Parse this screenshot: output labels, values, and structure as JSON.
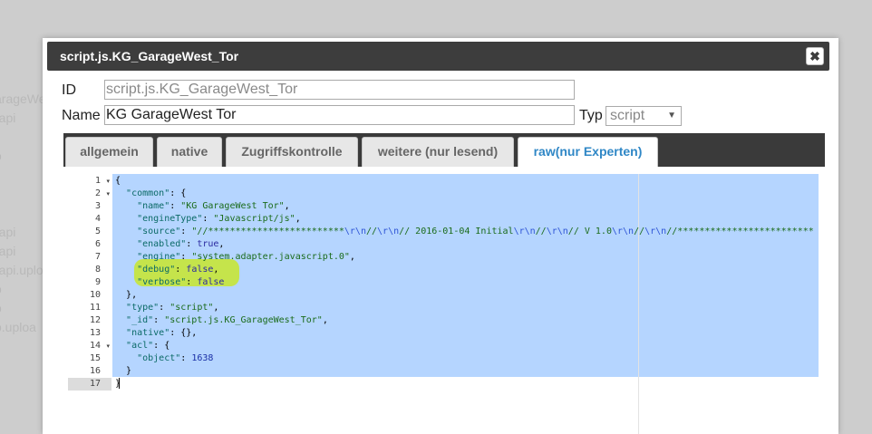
{
  "background": {
    "items": [
      "arageWe",
      "-api",
      "o",
      "-api",
      "-api",
      "-api.uplo",
      "o",
      "o",
      "o.uploa"
    ]
  },
  "dialog": {
    "title": "script.js.KG_GarageWest_Tor",
    "close_glyph": "✖"
  },
  "form": {
    "id_label": "ID",
    "id_value": "script.js.KG_GarageWest_Tor",
    "name_label": "Name",
    "name_value": "KG GarageWest Tor",
    "type_label": "Typ",
    "type_value": "script"
  },
  "tabs": [
    {
      "label": "allgemein"
    },
    {
      "label": "native"
    },
    {
      "label": "Zugriffskontrolle"
    },
    {
      "label": "weitere (nur lesend)"
    },
    {
      "label": "raw(nur Experten)"
    }
  ],
  "editor": {
    "line_numbers": [
      "1",
      "2",
      "3",
      "4",
      "5",
      "6",
      "7",
      "8",
      "9",
      "10",
      "11",
      "12",
      "13",
      "14",
      "15",
      "16",
      "17"
    ],
    "fold_marker": "▾",
    "code": {
      "l1_brace": "{",
      "l2_key": "\"common\"",
      "l2_rest": ": {",
      "l3_key": "\"name\"",
      "l3_val": "\"KG GarageWest Tor\"",
      "l4_key": "\"engineType\"",
      "l4_val": "\"Javascript/js\"",
      "l5_key": "\"source\"",
      "l5_a": "\"//*************************",
      "l5_b": "\\r\\n",
      "l5_c": "//",
      "l5_d": "\\r\\n",
      "l5_e": "// 2016-01-04 Initial",
      "l5_f": "\\r\\n",
      "l5_g": "//",
      "l5_h": "\\r\\n",
      "l5_i": "// V 1.0",
      "l5_j": "\\r\\n",
      "l5_k": "//",
      "l5_l": "\\r\\n",
      "l5_m": "//*************************",
      "l6_key": "\"enabled\"",
      "l6_val": "true",
      "l7_key": "\"engine\"",
      "l7_val": "\"system.adapter.javascript.0\"",
      "l8_key": "\"debug\"",
      "l8_val": "false",
      "l9_key": "\"verbose\"",
      "l9_val": "false",
      "l10_text": "},",
      "l11_key": "\"type\"",
      "l11_val": "\"script\"",
      "l12_key": "\"_id\"",
      "l12_val": "\"script.js.KG_GarageWest_Tor\"",
      "l13_key": "\"native\"",
      "l13_rest": ": {},",
      "l14_key": "\"acl\"",
      "l14_rest": ": {",
      "l15_key": "\"object\"",
      "l15_val": "1638",
      "l16_text": "}",
      "l17_text": "}"
    }
  }
}
